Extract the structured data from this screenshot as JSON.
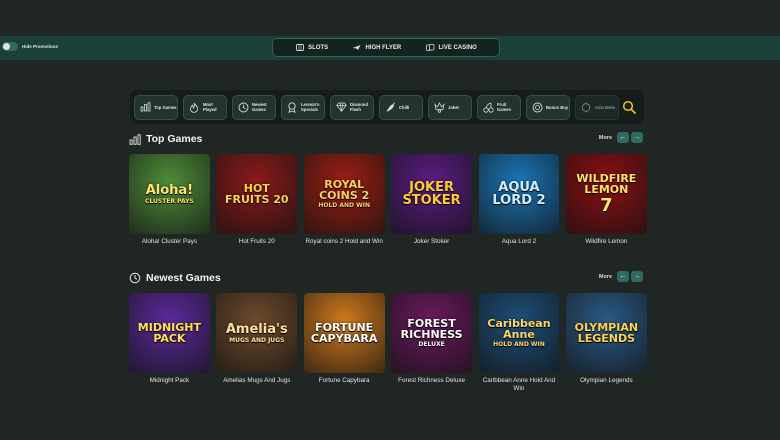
{
  "promotions": {
    "label": "Hide Promotions"
  },
  "modes": [
    {
      "label": "SLOTS",
      "icon": "slot-machine-icon"
    },
    {
      "label": "HIGH FLYER",
      "icon": "plane-icon"
    },
    {
      "label": "LIVE CASINO",
      "icon": "cards-icon"
    }
  ],
  "categories": [
    {
      "label": "Top Games",
      "icon": "bar-chart-icon"
    },
    {
      "label": "Most Played",
      "icon": "fire-icon"
    },
    {
      "label": "Newest Games",
      "icon": "clock-icon"
    },
    {
      "label": "Lennon's Specials",
      "icon": "badge-icon"
    },
    {
      "label": "Diamond Flash",
      "icon": "diamond-icon"
    },
    {
      "label": "Chilli",
      "icon": "chilli-icon"
    },
    {
      "label": "Joker",
      "icon": "joker-icon"
    },
    {
      "label": "Fruit Games",
      "icon": "cherry-icon"
    },
    {
      "label": "Bonus Buy",
      "icon": "coin-icon"
    },
    {
      "label": "Asia Belie",
      "icon": "lantern-icon"
    }
  ],
  "search": {
    "icon": "search-icon"
  },
  "top_games": {
    "title": "Top Games",
    "more": "More",
    "games": [
      {
        "name": "Aloha! Cluster Pays",
        "art": "Aloha!",
        "art_sub": "CLUSTER PAYS",
        "bg": "#4f8d3a",
        "fg": "#ffe36b"
      },
      {
        "name": "Hot Fruits 20",
        "art": "HOT FRUITS 20",
        "art_sub": "",
        "bg": "#8b1a1a",
        "fg": "#ffd24a"
      },
      {
        "name": "Royal coins 2 Hold and Win",
        "art": "ROYAL COINS 2",
        "art_sub": "HOLD AND WIN",
        "bg": "#9a1f14",
        "fg": "#ffd05a"
      },
      {
        "name": "Joker Stoker",
        "art": "JOKER STOKER",
        "art_sub": "",
        "bg": "#5a1d82",
        "fg": "#ffcc33"
      },
      {
        "name": "Aqua Lord 2",
        "art": "AQUA LORD 2",
        "art_sub": "",
        "bg": "#1b76b8",
        "fg": "#cdeeff"
      },
      {
        "name": "Wildfire Lemon",
        "art": "WILDFIRE LEMON",
        "art_sub": "7",
        "bg": "#8d0f14",
        "fg": "#ffe56a"
      }
    ]
  },
  "newest_games": {
    "title": "Newest Games",
    "more": "More",
    "games": [
      {
        "name": "Midnight Pack",
        "art": "MIDNIGHT PACK",
        "art_sub": "",
        "bg": "#5b2a9c",
        "fg": "#ffe14d"
      },
      {
        "name": "Amelias Mugs And Jugs",
        "art": "Amelia's",
        "art_sub": "MUGS AND JUGS",
        "bg": "#6d4a2c",
        "fg": "#ffe0a0"
      },
      {
        "name": "Fortune Capybara",
        "art": "FORTUNE CAPYBARA",
        "art_sub": "",
        "bg": "#d07a1c",
        "fg": "#ffffff"
      },
      {
        "name": "Forest Richness Deluxe",
        "art": "FOREST RICHNESS",
        "art_sub": "DELUXE",
        "bg": "#6a1a5e",
        "fg": "#ffffff"
      },
      {
        "name": "Caribbean Anne Hold And Win",
        "art": "Caribbean Anne",
        "art_sub": "HOLD AND WIN",
        "bg": "#1d4f7a",
        "fg": "#ffd66b"
      },
      {
        "name": "Olympian Legends",
        "art": "OLYMPIAN LEGENDS",
        "art_sub": "",
        "bg": "#2a5b86",
        "fg": "#ffd24a"
      }
    ]
  }
}
